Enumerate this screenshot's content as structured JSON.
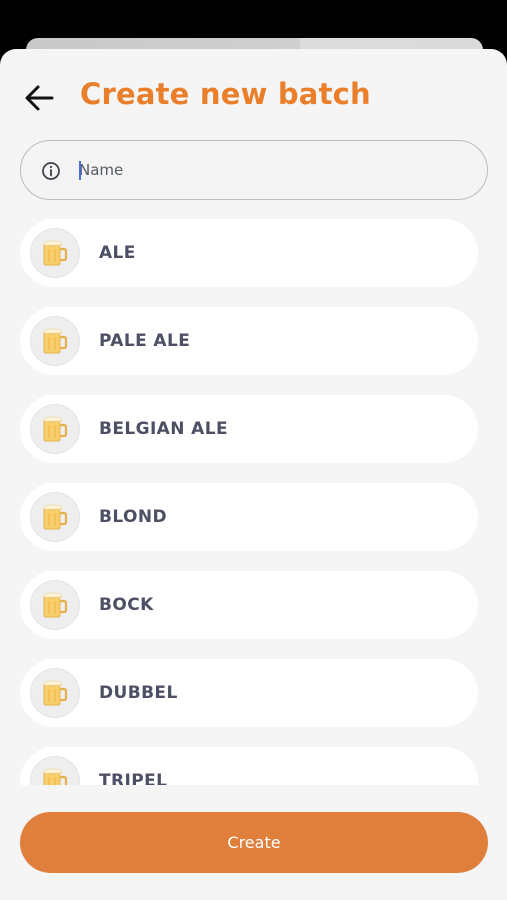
{
  "header": {
    "title": "Create new batch",
    "back_icon": "arrow-left-icon"
  },
  "name_field": {
    "placeholder": "Name",
    "value": "",
    "icon": "info-icon"
  },
  "beer_types": [
    {
      "label": "ALE",
      "icon": "beer-mug-icon"
    },
    {
      "label": "PALE ALE",
      "icon": "beer-mug-icon"
    },
    {
      "label": "BELGIAN ALE",
      "icon": "beer-mug-icon"
    },
    {
      "label": "BLOND",
      "icon": "beer-mug-icon"
    },
    {
      "label": "BOCK",
      "icon": "beer-mug-icon"
    },
    {
      "label": "DUBBEL",
      "icon": "beer-mug-icon"
    },
    {
      "label": "TRIPEL",
      "icon": "beer-mug-icon"
    }
  ],
  "footer": {
    "create_label": "Create"
  },
  "colors": {
    "accent": "#ea7f2b",
    "button": "#df7f3b",
    "label": "#4d5064",
    "background": "#f5f5f5"
  }
}
